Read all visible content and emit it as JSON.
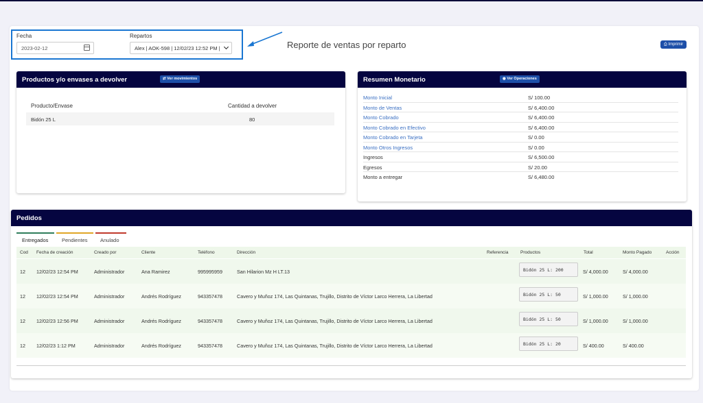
{
  "filters": {
    "fecha_label": "Fecha",
    "fecha_value": "2023-02-12",
    "repartos_label": "Repartos",
    "repartos_value": "Alex | AOK-598 | 12/02/23 12:52 PM |"
  },
  "report_title": "Reporte de ventas por reparto",
  "print_button": "Imprimir",
  "productos_panel": {
    "title": "Productos y/o envases a devolver",
    "button": "Ver movimientos",
    "col_product": "Producto/Envase",
    "col_qty": "Cantidad a devolver",
    "rows": [
      {
        "product": "Bidón 25 L",
        "qty": "80"
      }
    ]
  },
  "resumen_panel": {
    "title": "Resumen Monetario",
    "button": "Ver Operaciones",
    "rows": [
      {
        "label": "Monto Inicial",
        "value": "S/ 100.00"
      },
      {
        "label": "Monto de Ventas",
        "value": "S/ 6,400.00"
      },
      {
        "label": "Monto Cobrado",
        "value": "S/ 6,400.00"
      },
      {
        "label": "Monto Cobrado en Efectivo",
        "value": "S/ 6,400.00"
      },
      {
        "label": "Monto Cobrado en Tarjeta",
        "value": "S/ 0.00"
      },
      {
        "label": "Monto Otros Ingresos",
        "value": "S/ 0.00"
      },
      {
        "label": "Ingresos",
        "value": "S/ 6,500.00"
      },
      {
        "label": "Egresos",
        "value": "S/ 20.00"
      },
      {
        "label": "Monto a entregar",
        "value": "S/ 6,480.00"
      }
    ]
  },
  "pedidos": {
    "title": "Pedidos",
    "tabs": [
      {
        "label": "Entregados",
        "color": "#2e7d5b"
      },
      {
        "label": "Pendientes",
        "color": "#e0a526"
      },
      {
        "label": "Anulado",
        "color": "#c0392b"
      }
    ],
    "columns": {
      "cod": "Cod",
      "fecha": "Fecha de creación",
      "creado": "Creado por",
      "cliente": "Cliente",
      "telefono": "Teléfono",
      "direccion": "Dirección",
      "referencia": "Referencia",
      "productos": "Productos",
      "total": "Total",
      "monto": "Monto Pagado",
      "accion": "Acción"
    },
    "rows": [
      {
        "cod": "12",
        "fecha": "12/02/23 12:54 PM",
        "creado": "Administrador",
        "cliente": "Ana Ramirez",
        "telefono": "995995959",
        "direccion": "San Hilarion Mz H LT.13",
        "productos": "Bidón 25 L: 200",
        "total": "S/ 4,000.00",
        "monto": "S/ 4,000.00"
      },
      {
        "cod": "12",
        "fecha": "12/02/23 12:54 PM",
        "creado": "Administrador",
        "cliente": "Andrés Rodríguez",
        "telefono": "943357478",
        "direccion": "Cavero y Muñoz 174, Las Quintanas, Trujillo, Distrito de Víctor Larco Herrera, La Libertad",
        "productos": "Bidón 25 L: 50",
        "total": "S/ 1,000.00",
        "monto": "S/ 1,000.00"
      },
      {
        "cod": "12",
        "fecha": "12/02/23 12:56 PM",
        "creado": "Administrador",
        "cliente": "Andrés Rodríguez",
        "telefono": "943357478",
        "direccion": "Cavero y Muñoz 174, Las Quintanas, Trujillo, Distrito de Víctor Larco Herrera, La Libertad",
        "productos": "Bidón 25 L: 50",
        "total": "S/ 1,000.00",
        "monto": "S/ 1,000.00"
      },
      {
        "cod": "12",
        "fecha": "12/02/23 1:12 PM",
        "creado": "Administrador",
        "cliente": "Andrés Rodríguez",
        "telefono": "943357478",
        "direccion": "Cavero y Muñoz 174, Las Quintanas, Trujillo, Distrito de Víctor Larco Herrera, La Libertad",
        "productos": "Bidón 25 L: 20",
        "total": "S/ 400.00",
        "monto": "S/ 400.00"
      }
    ]
  }
}
